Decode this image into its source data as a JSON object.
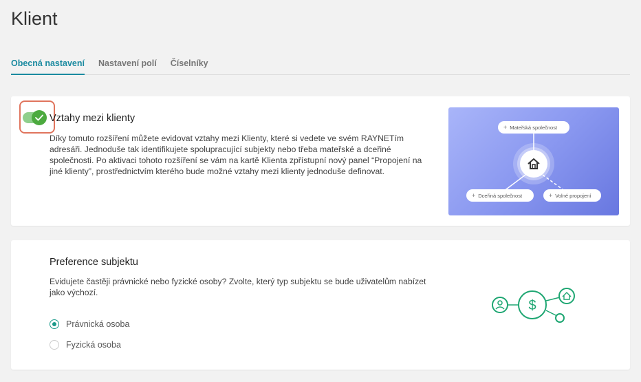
{
  "page": {
    "title": "Klient"
  },
  "tabs": [
    {
      "label": "Obecná nastavení",
      "active": true
    },
    {
      "label": "Nastavení polí",
      "active": false
    },
    {
      "label": "Číselníky",
      "active": false
    }
  ],
  "relations_card": {
    "title": "Vztahy mezi klienty",
    "enabled": true,
    "description": "Díky tomuto rozšíření můžete evidovat vztahy mezi Klienty, které si vedete ve svém RAYNETím adresáři. Jednoduše tak identifikujete spolupracující subjekty nebo třeba mateřské a dceřiné společnosti. Po aktivaci tohoto rozšíření se vám na kartě Klienta zpřístupní nový panel “Propojení na jiné klienty”, prostřednictvím kterého bude možné vztahy mezi klienty jednoduše definovat.",
    "illustration": {
      "parent_label": "Mateřská společnost",
      "child_label": "Dceřiná společnost",
      "free_label": "Volné propojení",
      "center_icon": "home-icon"
    }
  },
  "subject_card": {
    "title": "Preference subjektu",
    "description": "Evidujete častěji právnické nebo fyzické osoby? Zvolte, který typ subjektu se bude uživatelům nabízet jako výchozí.",
    "options": [
      {
        "label": "Právnická osoba",
        "selected": true
      },
      {
        "label": "Fyzická osoba",
        "selected": false
      }
    ]
  },
  "colors": {
    "accent": "#1a8aa0",
    "toggle_on": "#4caa3f",
    "illus_green": "#1ea672"
  }
}
